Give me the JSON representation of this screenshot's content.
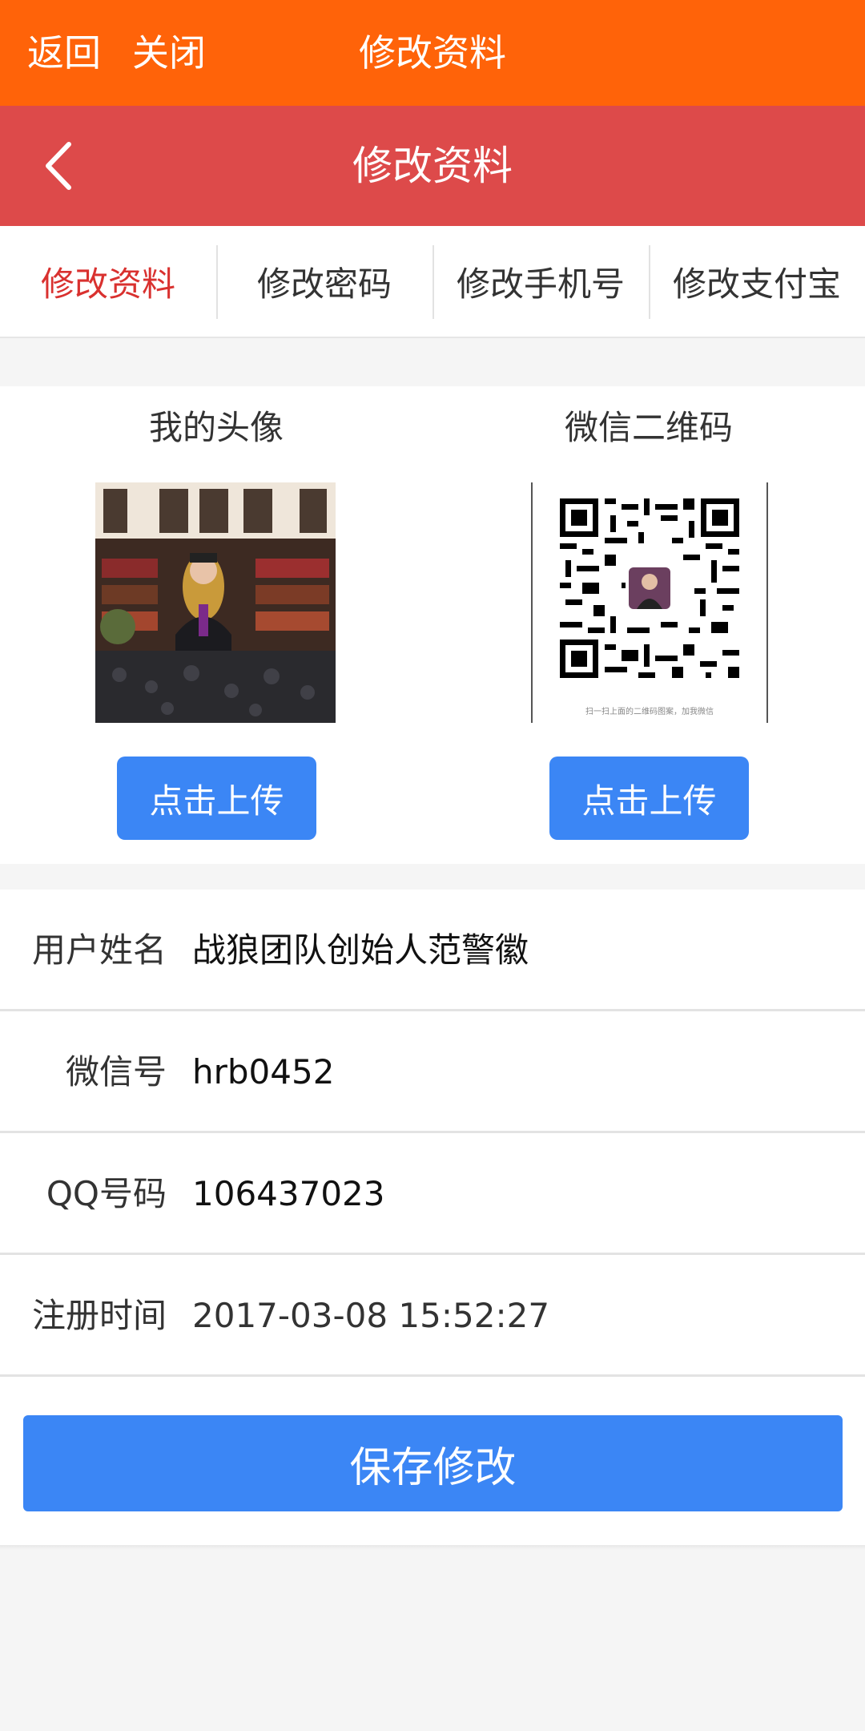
{
  "top_bar": {
    "back": "返回",
    "close": "关闭",
    "title": "修改资料"
  },
  "nav_bar": {
    "title": "修改资料"
  },
  "tabs": [
    {
      "label": "修改资料",
      "active": true
    },
    {
      "label": "修改密码",
      "active": false
    },
    {
      "label": "修改手机号",
      "active": false
    },
    {
      "label": "修改支付宝",
      "active": false
    }
  ],
  "avatar": {
    "title": "我的头像",
    "button": "点击上传"
  },
  "wechat_qr": {
    "title": "微信二维码",
    "button": "点击上传",
    "caption": "扫一扫上面的二维码图案，加我微信"
  },
  "form": {
    "username": {
      "label": "用户姓名",
      "value": "战狼团队创始人范警徽"
    },
    "wechat": {
      "label": "微信号",
      "value": "hrb0452"
    },
    "qq": {
      "label": "QQ号码",
      "value": "106437023"
    },
    "register_time": {
      "label": "注册时间",
      "value": "2017-03-08 15:52:27"
    }
  },
  "save_button": "保存修改",
  "colors": {
    "top_bar": "#ff6309",
    "nav_bar": "#dd4a4a",
    "active_tab": "#d9312f",
    "button": "#3b86f5"
  }
}
